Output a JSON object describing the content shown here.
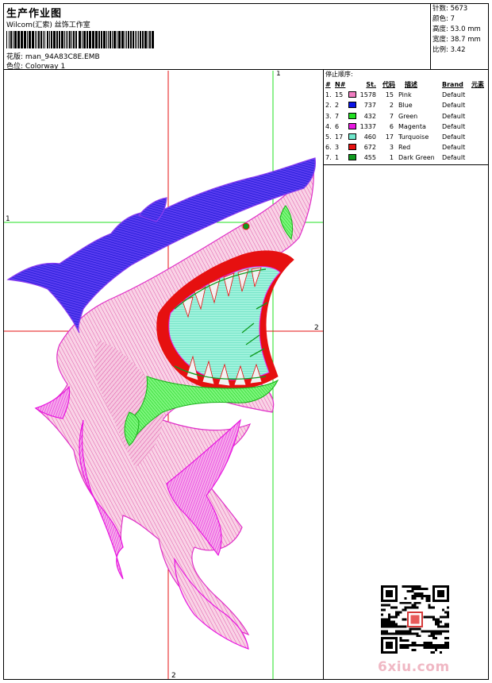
{
  "header": {
    "title": "生产作业图",
    "company": "Wilcom(汇索) 丝饰工作室",
    "design_label": "花版:",
    "design_name": "man_94A83C8E.EMB",
    "colorway_label": "色位:",
    "colorway_name": "Colorway 1"
  },
  "stats": {
    "stitches": "针数: 5673",
    "colors": "颜色: 7",
    "height": "高度: 53.0 mm",
    "width": "宽度: 38.7 mm",
    "scale": "比例: 3.42"
  },
  "stop_sequence": {
    "caption": "停止顺序:",
    "headers": [
      "#",
      "N#",
      "St.",
      "代码",
      "描述",
      "Brand",
      "元素"
    ],
    "rows": [
      {
        "idx": "1.",
        "n": "15",
        "color": "#f07cc0",
        "st": "1578",
        "code": "15",
        "desc": "Pink",
        "brand": "Default"
      },
      {
        "idx": "2.",
        "n": "2",
        "color": "#0a14e6",
        "st": "737",
        "code": "2",
        "desc": "Blue",
        "brand": "Default"
      },
      {
        "idx": "3.",
        "n": "7",
        "color": "#22e022",
        "st": "432",
        "code": "7",
        "desc": "Green",
        "brand": "Default"
      },
      {
        "idx": "4.",
        "n": "6",
        "color": "#e818e0",
        "st": "1337",
        "code": "6",
        "desc": "Magenta",
        "brand": "Default"
      },
      {
        "idx": "5.",
        "n": "17",
        "color": "#6ee8cc",
        "st": "460",
        "code": "17",
        "desc": "Turquoise",
        "brand": "Default"
      },
      {
        "idx": "6.",
        "n": "3",
        "color": "#e61010",
        "st": "672",
        "code": "3",
        "desc": "Red",
        "brand": "Default"
      },
      {
        "idx": "7.",
        "n": "1",
        "color": "#0f9a1e",
        "st": "455",
        "code": "1",
        "desc": "Dark Green",
        "brand": "Default"
      }
    ]
  },
  "guides": {
    "label_green_v": "1",
    "label_green_h": "1",
    "label_red_h": "2",
    "label_red_v": "2"
  },
  "watermark": "6xiu.com"
}
